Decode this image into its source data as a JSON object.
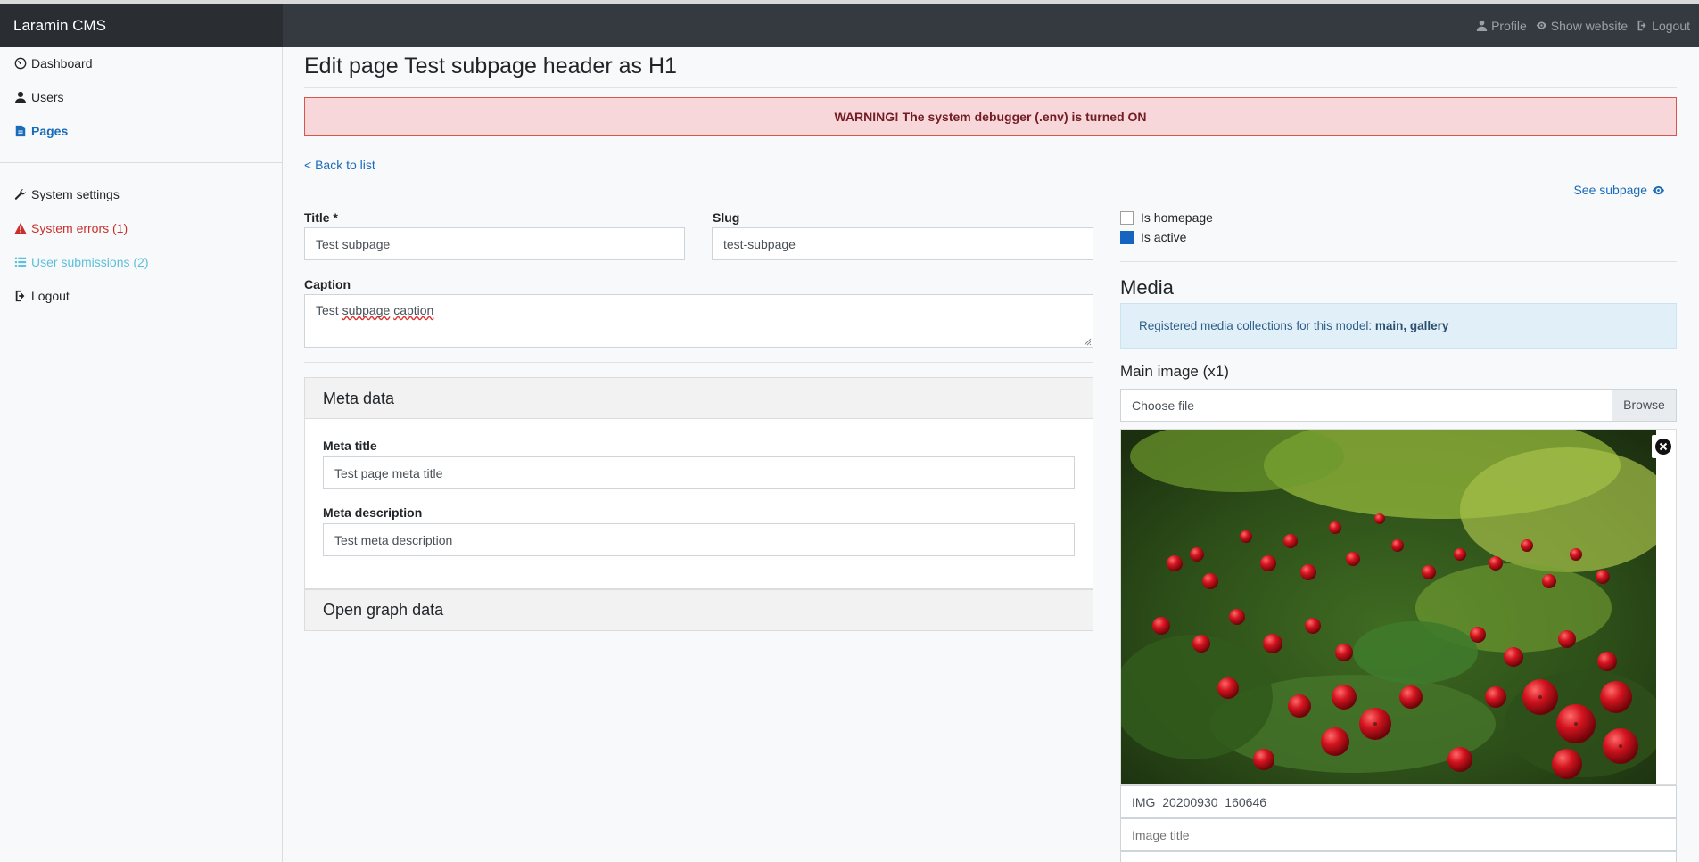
{
  "app": {
    "brand": "Laramin CMS"
  },
  "topnav": {
    "profile": "Profile",
    "show_website": "Show website",
    "logout": "Logout"
  },
  "sidebar": {
    "items": [
      {
        "label": "Dashboard",
        "icon": "dashboard-icon",
        "color": "#212529"
      },
      {
        "label": "Users",
        "icon": "user-icon",
        "color": "#212529"
      },
      {
        "label": "Pages",
        "icon": "file-icon",
        "color": "#1a6bb8",
        "active": true
      },
      {
        "label": "System settings",
        "icon": "wrench-icon",
        "color": "#212529"
      },
      {
        "label": "System errors (1)",
        "icon": "warning-icon",
        "color": "#c9302c"
      },
      {
        "label": "User submissions (2)",
        "icon": "list-icon",
        "color": "#5bc0de"
      },
      {
        "label": "Logout",
        "icon": "logout-icon",
        "color": "#212529"
      }
    ]
  },
  "page": {
    "title": "Edit page Test subpage header as H1",
    "warning": "WARNING! The system debugger (.env) is turned ON",
    "back_link": "< Back to list"
  },
  "form": {
    "title_label": "Title *",
    "title_value": "Test subpage",
    "slug_label": "Slug",
    "slug_value": "test-subpage",
    "caption_label": "Caption",
    "caption_prefix": "Test ",
    "caption_w1": "subpage",
    "caption_w2": "caption",
    "meta": {
      "heading": "Meta data",
      "title_label": "Meta title",
      "title_value": "Test page meta title",
      "description_label": "Meta description",
      "description_value": "Test meta description"
    },
    "og": {
      "heading": "Open graph data"
    }
  },
  "right": {
    "see_subpage": "See subpage",
    "is_homepage": {
      "label": "Is homepage",
      "checked": false
    },
    "is_active": {
      "label": "Is active",
      "checked": true
    },
    "media_title": "Media",
    "info_prefix": "Registered media collections for this model: ",
    "info_collections": "main, gallery",
    "main_image_label": "Main image (x1)",
    "file_placeholder": "Choose file",
    "browse": "Browse",
    "image_filename": "IMG_20200930_160646",
    "image_title_placeholder": "Image title"
  },
  "colors": {
    "accent": "#1a6bb8",
    "topbar": "#343a40",
    "danger": "#c9302c",
    "info": "#5bc0de"
  }
}
